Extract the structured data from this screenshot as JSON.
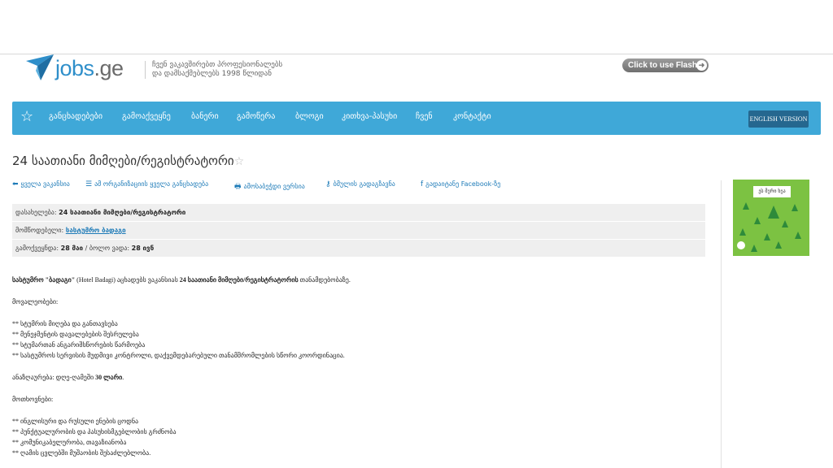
{
  "header": {
    "logo_text": "jobs",
    "logo_suffix": ".ge",
    "tagline_line1": "ჩვენ ვაკავშირებთ პროფესიონალებს",
    "tagline_line2": "და დამსაქმებლებს 1998 წლიდან",
    "flash_label": "Click to use Flash",
    "flash_arrow": "➜"
  },
  "nav": {
    "favorites_icon": "star-outline-icon",
    "items": [
      "განცხადებები",
      "გამოაქვეყნე",
      "ბანერი",
      "გამოწერა",
      "ბლოგი",
      "კითხვა-პასუხი",
      "ჩვენ",
      "კონტაქტი"
    ],
    "english_label": "ENGLISH VERSION"
  },
  "title": "24 საათიანი მიმღები/რეგისტრატორი",
  "title_fav": "☆",
  "actions": [
    {
      "icon": "back-arrow-icon",
      "glyph": "⬅",
      "label": "ყველა ვაკანსია"
    },
    {
      "icon": "list-icon",
      "glyph": "☰",
      "label": "ამ ორგანიზაციის ყველა განცხადება"
    },
    {
      "icon": "printer-icon",
      "glyph": "🖶",
      "label": "ამოსაბეჭდი ვერსია"
    },
    {
      "icon": "key-icon",
      "glyph": "⚷",
      "label": "ბმულის გადაგზავნა"
    },
    {
      "icon": "facebook-icon",
      "glyph": "f",
      "label": "გადაიტანე Facebook-ზე"
    }
  ],
  "info": {
    "position_label": "დასახელება:",
    "position_value": "24 საათიანი მიმღები/რეგისტრატორი",
    "provider_label": "მომწოდებელი:",
    "provider_value": "სასტუმრო ბადაგი",
    "published_label": "გამოქვეყნდა:",
    "published_value": "28 მაი",
    "separator": "/",
    "deadline_label": "ბოლო ვადა:",
    "deadline_value": "28 ივნ"
  },
  "ad": {
    "bubble_text": "ეს მერი ხეა"
  },
  "description": {
    "intro_company": "სასტუმრო \"ბადაგი\"",
    "intro_latin": " (Hotel Badagi) ",
    "intro_mid": "აცხადებს ვაკანსიას ",
    "intro_position": "24 საათიანი მიმღები/რეგისტრატორის",
    "intro_end": " თანამდებობაზე.",
    "duties_title": "მოვალეობები:",
    "duties": [
      "** სტუმრის მიღება და განთავსება",
      "** მენეჯმენტის დავალებების შესრულება",
      "** სტუმართან ანგარიშსწორების წარმოება",
      "** სასტუმროს სერვისის მუდმივი კონტროლი, დაქვემდებარებული თანამშრომლების სწორი კოორდინაცია."
    ],
    "salary_label": "ანაზღაურება: დღე-ღამეში ",
    "salary_value": "30 ლარი",
    "salary_end": ".",
    "requirements_title": "მოთხოვნები:",
    "requirements": [
      "** ინგლისური და რუსული ენების ცოდნა",
      "** პუნქტუალურობის და პასუხისმგებლობის გრძნობა",
      "** კომუნიკაბელურობა, თავაზიანობა",
      "** ღამის ცვლებში მუშაობის შესაძლებლობა."
    ]
  }
}
